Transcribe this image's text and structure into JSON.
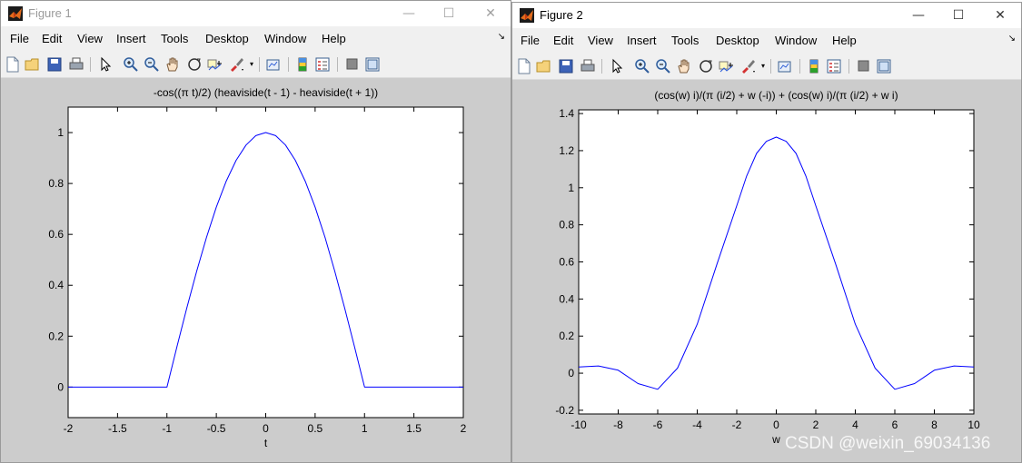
{
  "colors": {
    "curve": "#0000ff",
    "figure_bg": "#cccccc",
    "axes_bg": "#ffffff"
  },
  "menus": [
    "File",
    "Edit",
    "View",
    "Insert",
    "Tools",
    "Desktop",
    "Window",
    "Help"
  ],
  "toolbar_icons": [
    "new-figure-icon",
    "open-file-icon",
    "save-icon",
    "print-icon",
    "edit-plot-arrow-icon",
    "zoom-in-icon",
    "zoom-out-icon",
    "pan-hand-icon",
    "rotate-3d-icon",
    "data-cursor-icon",
    "brush-icon",
    "link-plot-icon",
    "colorbar-icon",
    "legend-icon",
    "hide-plot-tools-icon",
    "show-plot-tools-icon"
  ],
  "window_controls": {
    "minimize": "—",
    "maximize": "☐",
    "close": "✕"
  },
  "figure1": {
    "title": "Figure 1",
    "chart_data": {
      "type": "line",
      "title": "-cos((π t)/2) (heaviside(t - 1) - heaviside(t + 1))",
      "xlabel": "t",
      "ylabel": "",
      "xlim": [
        -2,
        2
      ],
      "ylim": [
        -0.12,
        1.1
      ],
      "xticks": [
        -2,
        -1.5,
        -1,
        -0.5,
        0,
        0.5,
        1,
        1.5,
        2
      ],
      "xtick_labels": [
        "-2",
        "-1.5",
        "-1",
        "-0.5",
        "0",
        "0.5",
        "1",
        "1.5",
        "2"
      ],
      "yticks": [
        0,
        0.2,
        0.4,
        0.6,
        0.8,
        1
      ],
      "ytick_labels": [
        "0",
        "0.2",
        "0.4",
        "0.6",
        "0.8",
        "1"
      ],
      "grid": false,
      "series": [
        {
          "x": [
            -2,
            -1,
            -0.9,
            -0.8,
            -0.7,
            -0.6,
            -0.5,
            -0.4,
            -0.3,
            -0.2,
            -0.1,
            0,
            0.1,
            0.2,
            0.3,
            0.4,
            0.5,
            0.6,
            0.7,
            0.8,
            0.9,
            1,
            2
          ],
          "y": [
            0,
            0,
            0.156,
            0.309,
            0.454,
            0.588,
            0.707,
            0.809,
            0.891,
            0.951,
            0.988,
            1,
            0.988,
            0.951,
            0.891,
            0.809,
            0.707,
            0.588,
            0.454,
            0.309,
            0.156,
            0,
            0
          ]
        }
      ]
    }
  },
  "figure2": {
    "title": "Figure 2",
    "chart_data": {
      "type": "line",
      "title": "(cos(w) i)/(π (i/2) + w (-i)) + (cos(w) i)/(π (i/2) + w i)",
      "xlabel": "w",
      "ylabel": "",
      "xlim": [
        -10,
        10
      ],
      "ylim": [
        -0.22,
        1.42
      ],
      "xticks": [
        -10,
        -8,
        -6,
        -4,
        -2,
        0,
        2,
        4,
        6,
        8,
        10
      ],
      "xtick_labels": [
        "-10",
        "-8",
        "-6",
        "-4",
        "-2",
        "0",
        "2",
        "4",
        "6",
        "8",
        "10"
      ],
      "yticks": [
        -0.2,
        0,
        0.2,
        0.4,
        0.6,
        0.8,
        1,
        1.2,
        1.4
      ],
      "ytick_labels": [
        "-0.2",
        "0",
        "0.2",
        "0.4",
        "0.6",
        "0.8",
        "1",
        "1.2",
        "1.4"
      ],
      "grid": false,
      "series": [
        {
          "x": [
            -10,
            -9,
            -8,
            -7,
            -6,
            -5,
            -4,
            -3,
            -2,
            -1.5,
            -1,
            -0.5,
            0,
            0.5,
            1,
            1.5,
            2,
            3,
            4,
            5,
            6,
            7,
            8,
            9,
            10
          ],
          "y": [
            0.033,
            0.039,
            0.016,
            -0.056,
            -0.087,
            0.027,
            0.264,
            0.589,
            0.903,
            1.063,
            1.185,
            1.25,
            1.273,
            1.25,
            1.185,
            1.063,
            0.903,
            0.589,
            0.264,
            0.027,
            -0.087,
            -0.056,
            0.016,
            0.039,
            0.033
          ]
        }
      ]
    }
  },
  "watermark": "CSDN @weixin_69034136"
}
